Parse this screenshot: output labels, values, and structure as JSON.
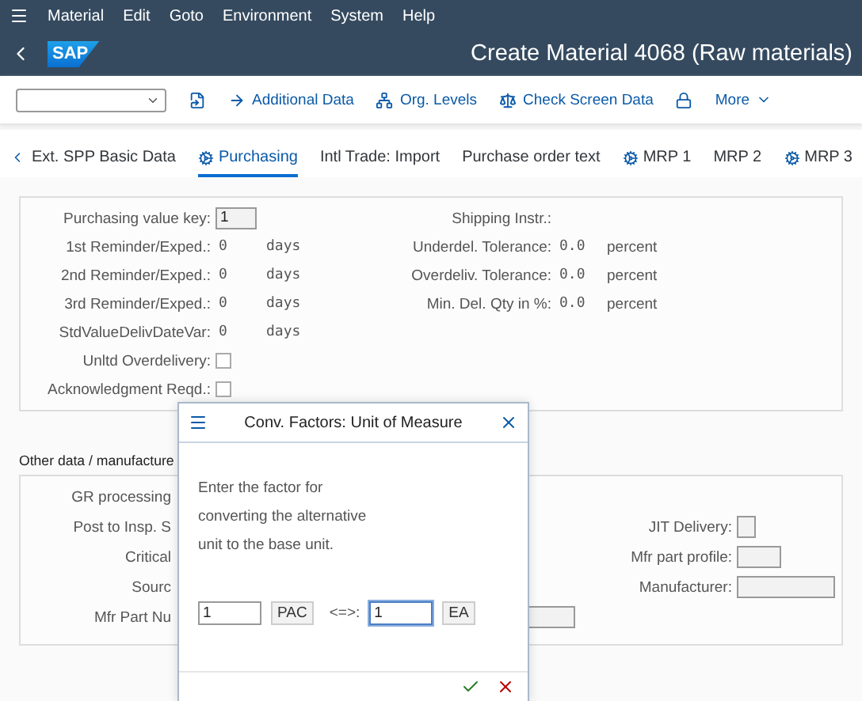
{
  "menu": [
    "Material",
    "Edit",
    "Goto",
    "Environment",
    "System",
    "Help"
  ],
  "header": {
    "logo": "SAP",
    "title": "Create Material 4068 (Raw materials)"
  },
  "toolbar": [
    {
      "kind": "dropdown"
    },
    {
      "kind": "document"
    },
    {
      "kind": "arrow",
      "label": "Additional Data"
    },
    {
      "kind": "org",
      "label": "Org. Levels"
    },
    {
      "kind": "scale",
      "label": "Check Screen Data"
    },
    {
      "kind": "lock"
    },
    {
      "kind": "more",
      "label": "More"
    }
  ],
  "tabs": [
    {
      "label": "Ext. SPP Basic Data",
      "selected": false,
      "icon": false
    },
    {
      "label": "Purchasing",
      "selected": true,
      "icon": true
    },
    {
      "label": "Intl Trade: Import",
      "selected": false,
      "icon": false
    },
    {
      "label": "Purchase order text",
      "selected": false,
      "icon": false
    },
    {
      "label": "MRP 1",
      "selected": false,
      "icon": true
    },
    {
      "label": "MRP 2",
      "selected": false,
      "icon": false
    },
    {
      "label": "MRP 3",
      "selected": false,
      "icon": true
    }
  ],
  "purchasing": {
    "left": [
      {
        "kind": "input",
        "label": "Purchasing value key:",
        "value": "1"
      },
      {
        "kind": "value",
        "label": "1st Reminder/Exped.:",
        "value": "0",
        "unit": "days"
      },
      {
        "kind": "value",
        "label": "2nd Reminder/Exped.:",
        "value": "0",
        "unit": "days"
      },
      {
        "kind": "value",
        "label": "3rd Reminder/Exped.:",
        "value": "0",
        "unit": "days"
      },
      {
        "kind": "value",
        "label": "StdValueDelivDateVar:",
        "value": "0",
        "unit": "days"
      },
      {
        "kind": "checkbox",
        "label": "Unltd Overdelivery:",
        "checked": false
      },
      {
        "kind": "checkbox",
        "label": "Acknowledgment Reqd.:",
        "checked": false
      }
    ],
    "right": [
      {
        "kind": "label",
        "label": "Shipping Instr.:"
      },
      {
        "kind": "value",
        "label": "Underdel. Tolerance:",
        "value": "0.0",
        "unit": "percent"
      },
      {
        "kind": "value",
        "label": "Overdeliv. Tolerance:",
        "value": "0.0",
        "unit": "percent"
      },
      {
        "kind": "value",
        "label": "Min. Del. Qty in %:",
        "value": "0.0",
        "unit": "percent"
      }
    ]
  },
  "other_data": {
    "title": "Other data / manufacture",
    "rows": [
      {
        "label": "GR processing",
        "right": null
      },
      {
        "label": "Post to Insp. S",
        "right": {
          "label": "JIT Delivery:",
          "kind": "checkbox",
          "checked": false
        }
      },
      {
        "label": "Critical",
        "right": {
          "label": "Mfr part profile:",
          "kind": "short"
        }
      },
      {
        "label": "Sourc",
        "right": {
          "label": "Manufacturer:",
          "kind": "long"
        }
      },
      {
        "label": "Mfr Part Nu",
        "right": null,
        "field": true
      }
    ]
  },
  "dialog": {
    "title": "Conv. Factors: Unit of Measure",
    "message": [
      "Enter the factor for",
      "converting the alternative",
      "unit to the base unit."
    ],
    "fields": [
      {
        "kind": "input",
        "value": "1",
        "focused": false
      },
      {
        "kind": "unit",
        "value": "PAC"
      },
      {
        "kind": "separator",
        "value": "<=>:"
      },
      {
        "kind": "input",
        "value": "1",
        "focused": true
      },
      {
        "kind": "unit",
        "value": "EA"
      }
    ]
  }
}
